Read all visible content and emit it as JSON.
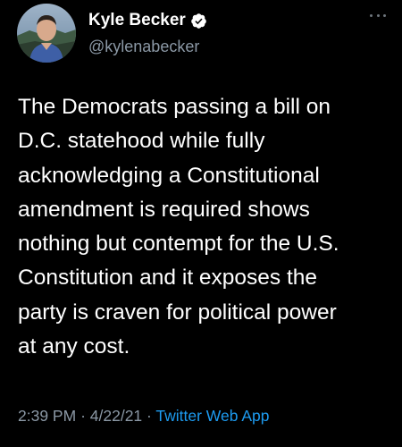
{
  "user": {
    "display_name": "Kyle Becker",
    "handle": "@kylenabecker",
    "verified": true,
    "avatar_icon": "user-avatar-photo"
  },
  "tweet": {
    "lines": [
      "The Democrats passing a bill on",
      "D.C. statehood while fully",
      "acknowledging a Constitutional",
      "amendment is required shows",
      "nothing but contempt for the U.S.",
      "Constitution and it exposes the",
      "party is craven for political power",
      "at any cost."
    ]
  },
  "meta": {
    "time": "2:39 PM",
    "separator": "·",
    "date": "4/22/21",
    "source": "Twitter Web App"
  },
  "colors": {
    "background": "#000000",
    "text": "#ffffff",
    "muted": "#8b98a5",
    "link": "#1d9bf0"
  },
  "icons": {
    "verified": "verified-badge-icon",
    "more": "more-options-icon"
  }
}
